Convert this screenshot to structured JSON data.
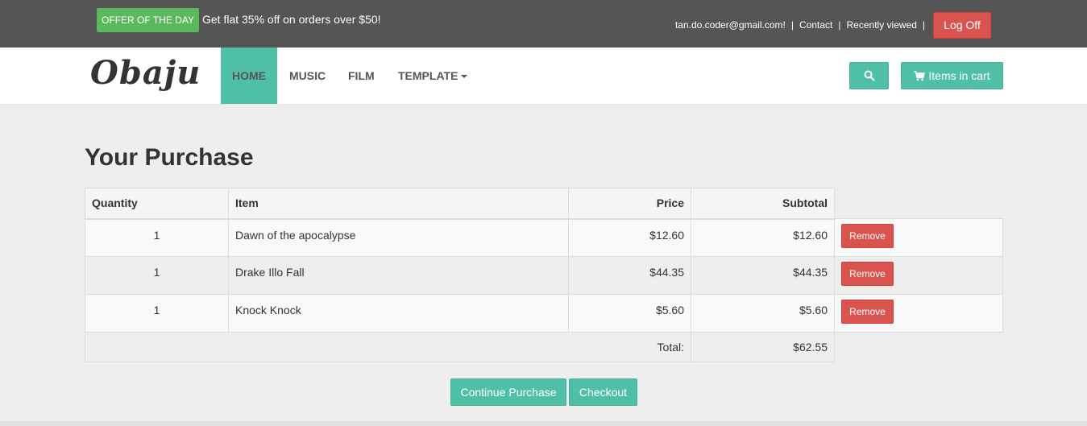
{
  "topbar": {
    "offer_badge": "OFFER OF THE DAY",
    "offer_text": "Get flat 35% off on orders over $50!",
    "email": "tan.do.coder@gmail.com!",
    "contact": "Contact",
    "recently_viewed": "Recently viewed",
    "logoff": "Log Off",
    "separator": "|"
  },
  "navbar": {
    "logo": "Obaju",
    "items": [
      "HOME",
      "MUSIC",
      "FILM",
      "TEMPLATE"
    ],
    "active_item": "HOME",
    "cart_label": "Items in cart"
  },
  "page": {
    "title": "Your Purchase"
  },
  "cart_table": {
    "headers": [
      "Quantity",
      "Item",
      "Price",
      "Subtotal"
    ],
    "rows": [
      {
        "quantity": "1",
        "item": "Dawn of the apocalypse",
        "price": "$12.60",
        "subtotal": "$12.60",
        "action": "Remove"
      },
      {
        "quantity": "1",
        "item": "Drake Illo Fall",
        "price": "$44.35",
        "subtotal": "$44.35",
        "action": "Remove"
      },
      {
        "quantity": "1",
        "item": "Knock Knock",
        "price": "$5.60",
        "subtotal": "$5.60",
        "action": "Remove"
      }
    ],
    "total_label": "Total:",
    "total_value": "$62.55"
  },
  "actions": {
    "continue": "Continue Purchase",
    "checkout": "Checkout"
  },
  "colors": {
    "accent": "#4fbfa8",
    "danger": "#d9534f",
    "success": "#5cb85c",
    "topbar": "#555555"
  },
  "icons": {
    "search": "search-icon",
    "cart": "shopping-cart-icon",
    "dropdown": "caret-down-icon"
  }
}
